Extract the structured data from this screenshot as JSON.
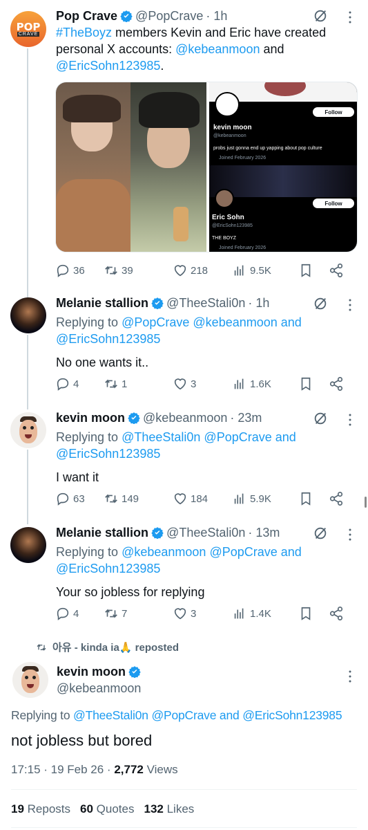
{
  "thread": [
    {
      "name": "Pop Crave",
      "handle": "@PopCrave",
      "time": "· 1h",
      "avatar_text": "POP",
      "avatar_sub": "CRAVE",
      "text_parts": [
        "#TheBoyz",
        " members Kevin and Eric have created personal X accounts: ",
        "@kebeanmoon",
        " and ",
        "@EricSohn123985",
        "."
      ],
      "media": {
        "card1_name": "kevin moon",
        "card1_handle": "@kebeanmoon",
        "card1_bio": "probs just gonna end up yapping about pop culture",
        "card1_joined": "Joined February 2026",
        "card2_name": "Eric Sohn",
        "card2_handle": "@EricSohn123985",
        "card2_bio": "THE BOYZ",
        "card2_joined": "Joined February 2026",
        "follow_label": "Follow"
      },
      "stats": {
        "replies": "36",
        "reposts": "39",
        "likes": "218",
        "views": "9.5K"
      }
    },
    {
      "name": "Melanie stallion",
      "handle": "@TheeStali0n",
      "time": "· 1h",
      "reply_parts": [
        "Replying to ",
        "@PopCrave",
        " ",
        "@kebeanmoon",
        " and",
        "@EricSohn123985"
      ],
      "text": "No one wants it..",
      "stats": {
        "replies": "4",
        "reposts": "1",
        "likes": "3",
        "views": "1.6K"
      }
    },
    {
      "name": "kevin moon",
      "handle": "@kebeanmoon",
      "time": "· 23m",
      "reply_parts": [
        "Replying to ",
        "@TheeStali0n",
        " ",
        "@PopCrave",
        " and",
        "@EricSohn123985"
      ],
      "text": "I want it",
      "stats": {
        "replies": "63",
        "reposts": "149",
        "likes": "184",
        "views": "5.9K"
      }
    },
    {
      "name": "Melanie stallion",
      "handle": "@TheeStali0n",
      "time": "· 13m",
      "reply_parts": [
        "Replying to ",
        "@kebeanmoon",
        " ",
        "@PopCrave",
        " and",
        "@EricSohn123985"
      ],
      "text": "Your so jobless for replying",
      "stats": {
        "replies": "4",
        "reposts": "7",
        "likes": "3",
        "views": "1.4K"
      }
    }
  ],
  "repost_banner": {
    "user": "아유 - kinda ia🙏",
    "label": " reposted"
  },
  "main_tweet": {
    "name": "kevin moon",
    "handle": "@kebeanmoon",
    "reply_prefix": "Replying to ",
    "reply_mentions": [
      "@TheeStali0n",
      "@PopCrave",
      "@EricSohn123985"
    ],
    "reply_and": "and",
    "text": "not jobless but bored",
    "timestamp": "17:15 · 19 Feb 26 · ",
    "views_count": "2,772",
    "views_label": " Views",
    "reposts_count": "19",
    "reposts_label": " Reposts",
    "quotes_count": "60",
    "quotes_label": " Quotes",
    "likes_count": "132",
    "likes_label": " Likes"
  },
  "colors": {
    "accent": "#1d9bf0",
    "verified": "#1d9bf0",
    "muted": "#536471"
  }
}
